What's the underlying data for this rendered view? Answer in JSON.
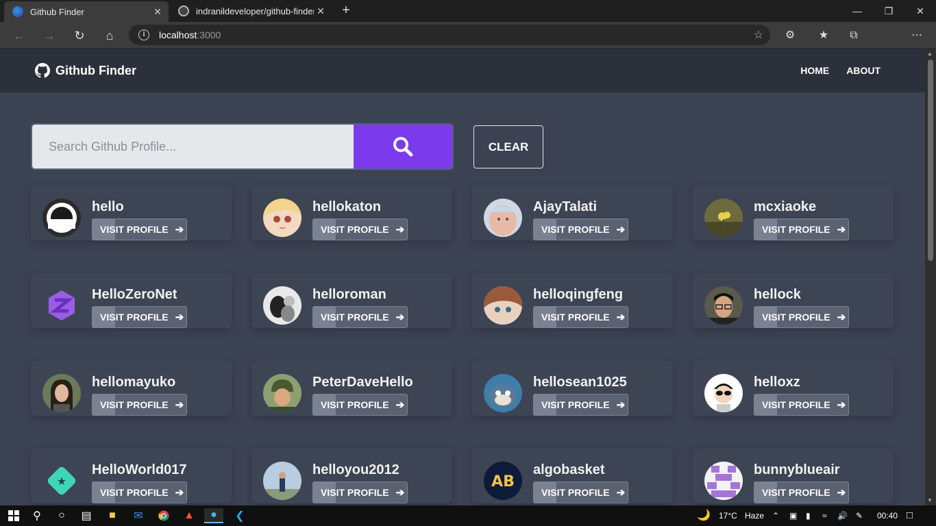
{
  "browser": {
    "tabs": [
      {
        "title": "Github Finder",
        "active": true
      },
      {
        "title": "indranildeveloper/github-finder-",
        "active": false
      }
    ],
    "url_host": "localhost",
    "url_port": ":3000",
    "window_controls": [
      "minimize",
      "restore",
      "close"
    ]
  },
  "app": {
    "brand": "Github Finder",
    "nav": {
      "home": "HOME",
      "about": "ABOUT"
    },
    "search": {
      "placeholder": "Search Github Profile..."
    },
    "clear_label": "CLEAR",
    "visit_label": "VISIT PROFILE",
    "users": [
      {
        "login": "hello",
        "avatar": "black-circle-smile"
      },
      {
        "login": "hellokaton",
        "avatar": "anime-blonde"
      },
      {
        "login": "AjayTalati",
        "avatar": "baby-photo"
      },
      {
        "login": "mcxiaoke",
        "avatar": "yellow-flower"
      },
      {
        "login": "HelloZeroNet",
        "avatar": "purple-z-logo"
      },
      {
        "login": "helloroman",
        "avatar": "bw-dog-photo"
      },
      {
        "login": "helloqingfeng",
        "avatar": "anime-brown-hair"
      },
      {
        "login": "hellock",
        "avatar": "person-glasses"
      },
      {
        "login": "hellomayuko",
        "avatar": "woman-photo"
      },
      {
        "login": "PeterDaveHello",
        "avatar": "man-helmet"
      },
      {
        "login": "hellosean1025",
        "avatar": "cartoon-cat"
      },
      {
        "login": "helloxz",
        "avatar": "cartoon-sunglasses"
      },
      {
        "login": "HelloWorld017",
        "avatar": "teal-star-logo"
      },
      {
        "login": "helloyou2012",
        "avatar": "person-sky"
      },
      {
        "login": "algobasket",
        "avatar": "ab-logo"
      },
      {
        "login": "bunnyblueair",
        "avatar": "purple-identicon"
      }
    ]
  },
  "taskbar": {
    "weather": "17°C",
    "weather_desc": "Haze",
    "time": "00:40"
  },
  "colors": {
    "accent": "#7c3aed",
    "navbar": "#2b303b",
    "background": "#3b4252",
    "card": "#3d4454"
  }
}
